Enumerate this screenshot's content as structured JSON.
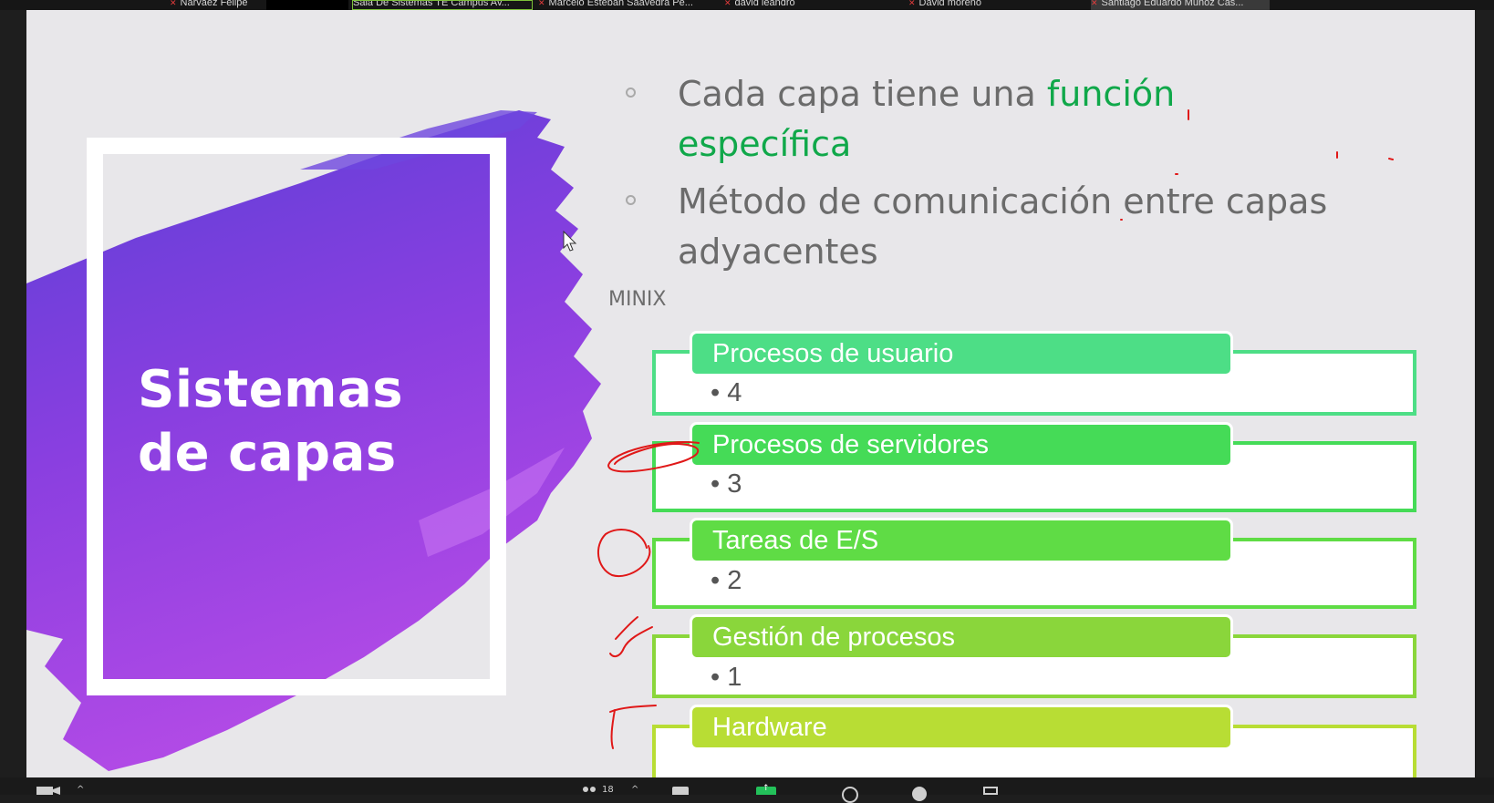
{
  "participants": [
    {
      "name": "Narvaez Felipe",
      "muted": true
    },
    {
      "name": "Sala De Sistemas TE Campus Av...",
      "active": true
    },
    {
      "name": "Marcelo Esteban Saavedra Pe...",
      "muted": true
    },
    {
      "name": "david leandro",
      "muted": true
    },
    {
      "name": "David moreno",
      "muted": true
    },
    {
      "name": "Santiago Eduardo Muñoz Cas...",
      "muted": true
    }
  ],
  "slide": {
    "title_line1": "Sistemas",
    "title_line2": "de capas",
    "bullets": [
      {
        "text": "Cada capa tiene una ",
        "highlight_line1": "función",
        "highlight_line2": "específica"
      },
      {
        "line1": "Método de comunicación entre capas",
        "line2": "adyacentes"
      }
    ],
    "minix_label": "MINIX",
    "layers": [
      {
        "name": "Procesos de usuario",
        "value": "• 4",
        "color": "#4dde86"
      },
      {
        "name": "Procesos de servidores",
        "value": "• 3",
        "color": "#45db57"
      },
      {
        "name": "Tareas de E/S",
        "value": "• 2",
        "color": "#5fdc45"
      },
      {
        "name": "Gestión de procesos",
        "value": "• 1",
        "color": "#8ad63b"
      },
      {
        "name": "Hardware",
        "value": "",
        "color": "#b8dd34"
      }
    ],
    "ink_color": "#e01818"
  },
  "toolbar": {
    "participants_count": "18"
  }
}
